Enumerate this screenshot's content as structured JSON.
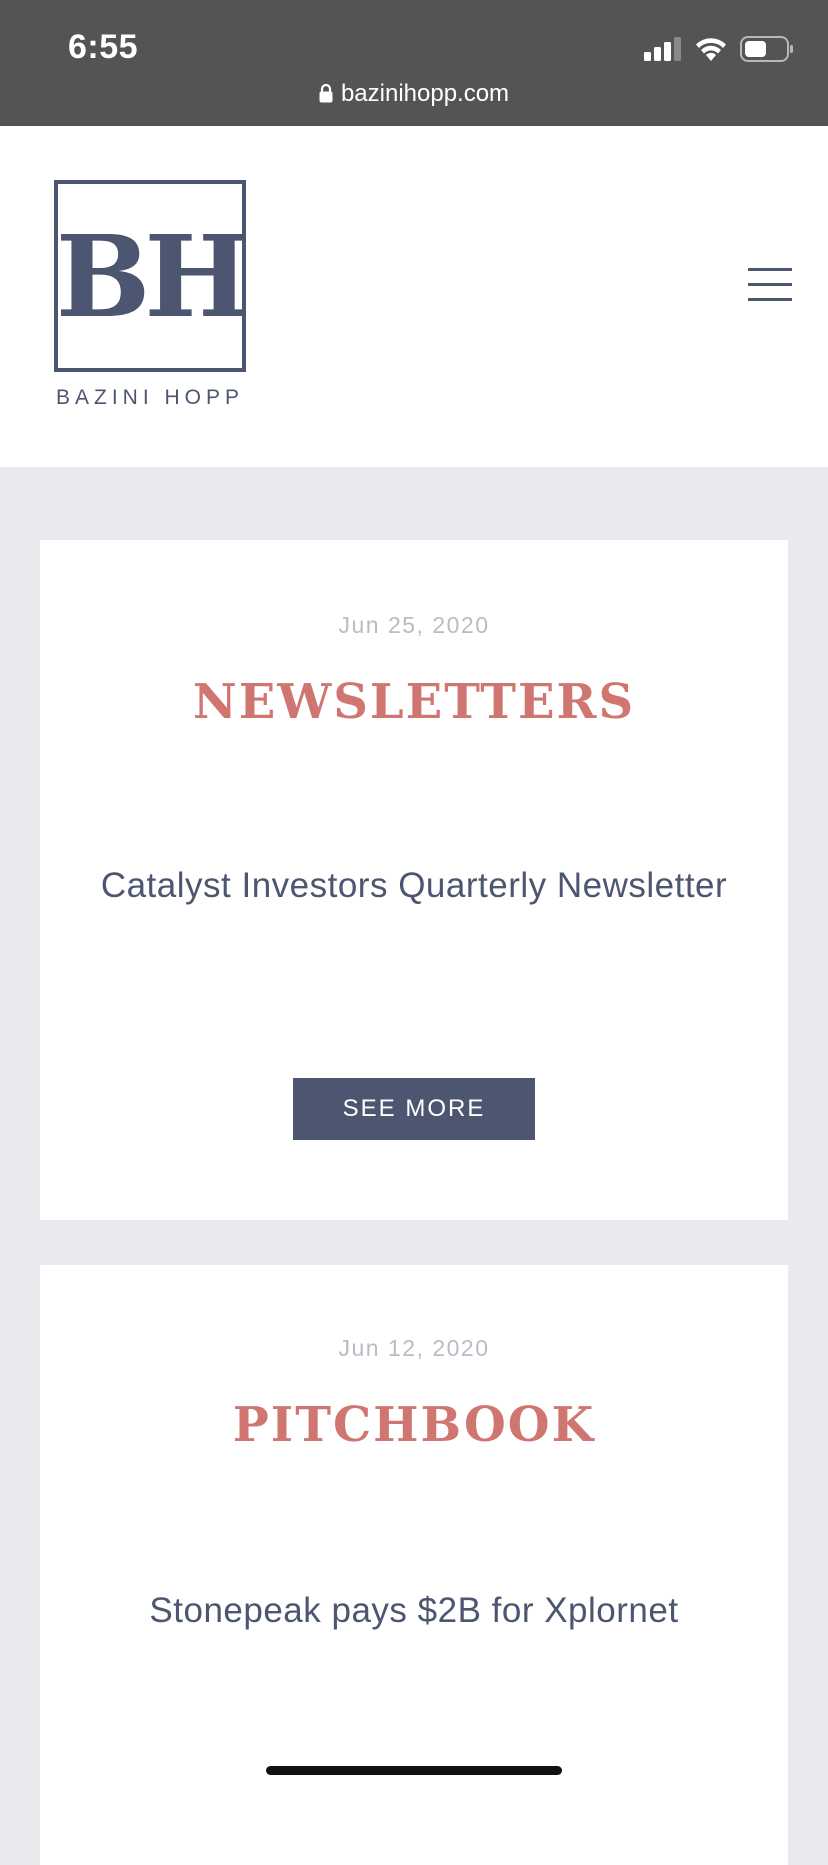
{
  "status_bar": {
    "time": "6:55",
    "url": "bazinihopp.com",
    "icons": [
      "signal-icon",
      "wifi-icon",
      "battery-icon",
      "lock-icon"
    ]
  },
  "header": {
    "logo_mark": "BH",
    "logo_wordmark": "BAZINI HOPP",
    "menu_icon": "hamburger-menu-icon"
  },
  "colors": {
    "brand_navy": "#4d5670",
    "accent_coral": "#d07671",
    "page_bg": "#e9eaee",
    "status_bar_bg": "#545456"
  },
  "posts": [
    {
      "date": "Jun 25, 2020",
      "category": "NEWSLETTERS",
      "title": "Catalyst Investors Quarterly Newsletter",
      "button_label": "SEE MORE"
    },
    {
      "date": "Jun 12, 2020",
      "category": "PITCHBOOK",
      "title": "Stonepeak pays $2B for Xplornet"
    }
  ]
}
